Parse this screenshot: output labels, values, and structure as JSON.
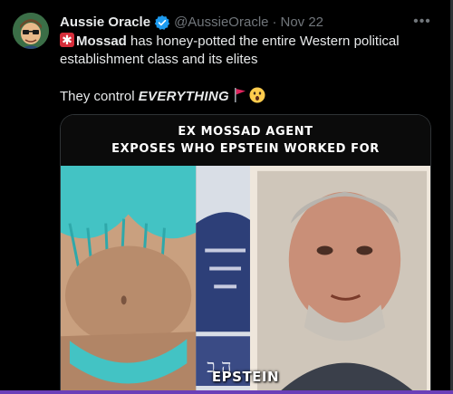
{
  "post": {
    "display_name": "Aussie Oracle",
    "handle": "@AussieOracle",
    "separator": "·",
    "date": "Nov 22",
    "more_label": "•••",
    "text": {
      "lead_bold": "Mossad",
      "line1_rest": " has honey-potted the entire Western political",
      "line2": "establishment class and its elites",
      "line3_start": "They control ",
      "line3_emphasis": "EVERYTHING"
    },
    "icons": {
      "avatar": "avatar-cartoon",
      "verified": "verified-badge-icon",
      "siren": "rotating-light-emoji",
      "flag": "red-flag-emoji",
      "face": "astonished-face-emoji"
    },
    "colors": {
      "background": "#000000",
      "text": "#e7e9ea",
      "muted": "#71767b",
      "verified": "#1d9bf0",
      "flag": "#e0245e",
      "bar": "#6b3fb8"
    }
  },
  "media": {
    "banner_line1": "EX MOSSAD AGENT",
    "banner_line2": "EXPOSES WHO EPSTEIN WORKED FOR",
    "caption": "EPSTEIN"
  }
}
